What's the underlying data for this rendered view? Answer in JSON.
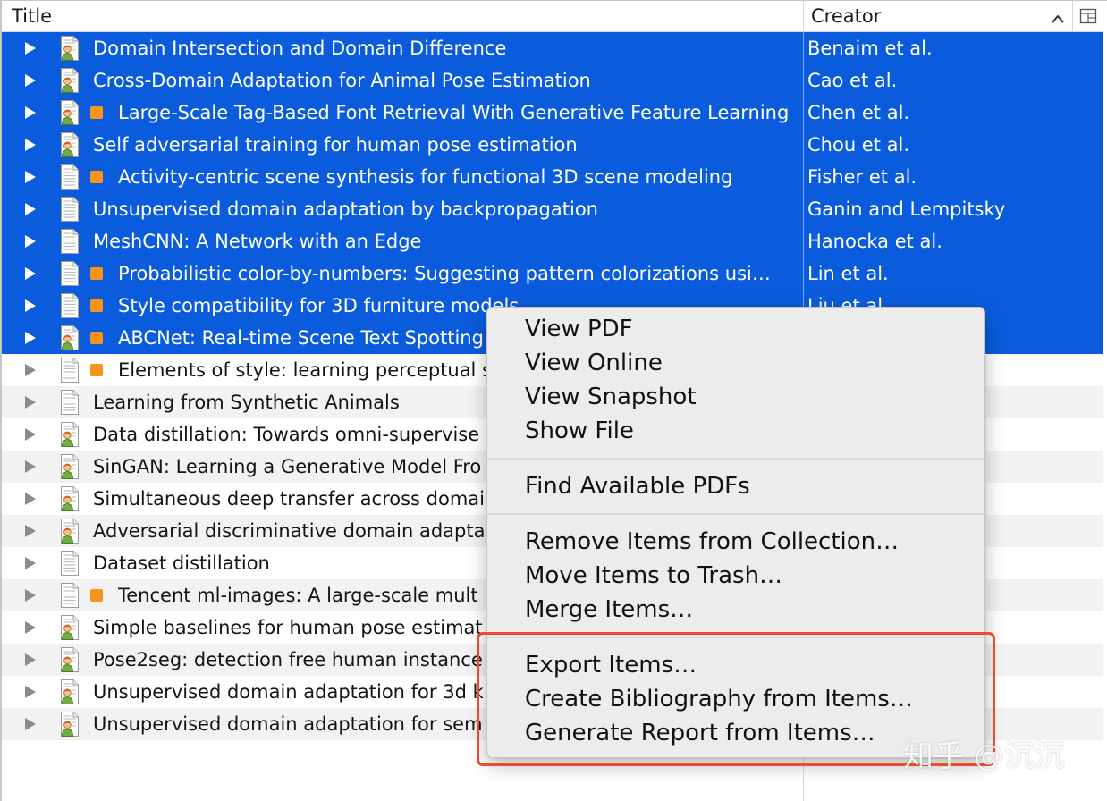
{
  "header": {
    "title_label": "Title",
    "creator_label": "Creator",
    "sort_icon": "chevron-up-icon",
    "column_picker_icon": "column-picker-icon"
  },
  "colors": {
    "selection": "#0b5cdc",
    "stripe": "#f2f2f2",
    "tag": "#f7941d",
    "highlight": "#ee4a2c"
  },
  "rows": [
    {
      "title": "Domain Intersection and Domain Difference",
      "creator": "Benaim et al.",
      "icon": "person-document-icon",
      "tagged": false,
      "selected": true
    },
    {
      "title": "Cross-Domain Adaptation for Animal Pose Estimation",
      "creator": "Cao et al.",
      "icon": "person-document-icon",
      "tagged": false,
      "selected": true
    },
    {
      "title": "Large-Scale Tag-Based Font Retrieval With Generative Feature Learning",
      "creator": "Chen et al.",
      "icon": "person-document-icon",
      "tagged": true,
      "selected": true
    },
    {
      "title": "Self adversarial training for human pose estimation",
      "creator": "Chou et al.",
      "icon": "person-document-icon",
      "tagged": false,
      "selected": true
    },
    {
      "title": "Activity-centric scene synthesis for functional 3D scene modeling",
      "creator": "Fisher et al.",
      "icon": "document-icon",
      "tagged": true,
      "selected": true
    },
    {
      "title": "Unsupervised domain adaptation by backpropagation",
      "creator": "Ganin and Lempitsky",
      "icon": "document-icon",
      "tagged": false,
      "selected": true
    },
    {
      "title": "MeshCNN: A Network with an Edge",
      "creator": "Hanocka et al.",
      "icon": "document-icon",
      "tagged": false,
      "selected": true
    },
    {
      "title": "Probabilistic color-by-numbers: Suggesting pattern colorizations usi…",
      "creator": "Lin et al.",
      "icon": "document-icon",
      "tagged": true,
      "selected": true
    },
    {
      "title": "Style compatibility for 3D furniture models",
      "creator": "Liu et al.",
      "icon": "document-icon",
      "tagged": true,
      "selected": true
    },
    {
      "title": "ABCNet: Real-time Scene Text Spotting",
      "creator": "",
      "icon": "person-document-icon",
      "tagged": true,
      "selected": true
    },
    {
      "title": "Elements of style: learning perceptual s",
      "creator": "",
      "icon": "document-icon",
      "tagged": true,
      "selected": false
    },
    {
      "title": "Learning from Synthetic Animals",
      "creator": "",
      "icon": "document-icon",
      "tagged": false,
      "selected": false
    },
    {
      "title": "Data distillation: Towards omni-supervise",
      "creator": "",
      "icon": "person-document-icon",
      "tagged": false,
      "selected": false
    },
    {
      "title": "SinGAN: Learning a Generative Model Fro",
      "creator": "",
      "icon": "person-document-icon",
      "tagged": false,
      "selected": false
    },
    {
      "title": "Simultaneous deep transfer across domai",
      "creator": "",
      "icon": "person-document-icon",
      "tagged": false,
      "selected": false
    },
    {
      "title": "Adversarial discriminative domain adapta",
      "creator": "",
      "icon": "person-document-icon",
      "tagged": false,
      "selected": false
    },
    {
      "title": "Dataset distillation",
      "creator": "",
      "icon": "document-icon",
      "tagged": false,
      "selected": false
    },
    {
      "title": "Tencent ml-images: A large-scale mult",
      "creator": "",
      "icon": "document-icon",
      "tagged": true,
      "selected": false
    },
    {
      "title": "Simple baselines for human pose estimat",
      "creator": "",
      "icon": "person-document-icon",
      "tagged": false,
      "selected": false
    },
    {
      "title": "Pose2seg: detection free human instance",
      "creator": "",
      "icon": "person-document-icon",
      "tagged": false,
      "selected": false
    },
    {
      "title": "Unsupervised domain adaptation for 3d k",
      "creator": "",
      "icon": "person-document-icon",
      "tagged": false,
      "selected": false
    },
    {
      "title": "Unsupervised domain adaptation for sem",
      "creator": "",
      "icon": "person-document-icon",
      "tagged": false,
      "selected": false
    }
  ],
  "context_menu": {
    "groups": [
      [
        "View PDF",
        "View Online",
        "View Snapshot",
        "Show File"
      ],
      [
        "Find Available PDFs"
      ],
      [
        "Remove Items from Collection…",
        "Move Items to Trash…",
        "Merge Items…"
      ],
      [
        "Export Items…",
        "Create Bibliography from Items…",
        "Generate Report from Items…"
      ]
    ]
  },
  "watermark": "知乎 @沉沉"
}
